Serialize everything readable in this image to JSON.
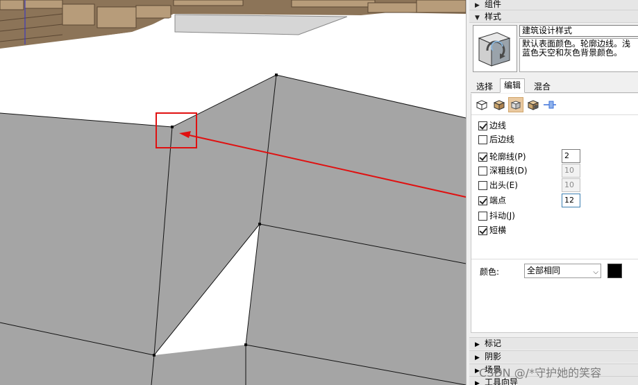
{
  "panel": {
    "top_tray": {
      "arrow": "▶",
      "label": "组件"
    },
    "style_tray": {
      "arrow": "▼",
      "label": "样式"
    },
    "style_name": "建筑设计样式",
    "style_description": "默认表面颜色。轮廓边线。浅蓝色天空和灰色背景颜色。",
    "tabs": [
      {
        "label": "选择"
      },
      {
        "label": "编辑"
      },
      {
        "label": "混合"
      }
    ],
    "edge_settings": {
      "edges": {
        "label": "边线",
        "checked": true
      },
      "back_edges": {
        "label": "后边线",
        "checked": false
      },
      "profiles": {
        "label": "轮廓线(P)",
        "checked": true,
        "value": "2"
      },
      "depth_cue": {
        "label": "深粗线(D)",
        "checked": false,
        "value": "10"
      },
      "extension": {
        "label": "出头(E)",
        "checked": false,
        "value": "10"
      },
      "endpoints": {
        "label": "端点",
        "checked": true,
        "value": "12"
      },
      "jitter": {
        "label": "抖动(J)",
        "checked": false
      },
      "short_dash": {
        "label": "短横",
        "checked": true
      }
    },
    "color": {
      "label": "颜色:",
      "selected": "全部相同",
      "swatch": "#000000"
    },
    "lower_trays": [
      {
        "arrow": "▶",
        "label": "标记"
      },
      {
        "arrow": "▶",
        "label": "阴影"
      },
      {
        "arrow": "▶",
        "label": "场景"
      },
      {
        "arrow": "▶",
        "label": "工具向导"
      }
    ]
  },
  "viewport": {
    "wall_color": "#a5a5a5",
    "highlight_color": "#e01010",
    "roof_color": "#ffffff",
    "ground_color": "#8c7458"
  },
  "watermark": "CSDN @/*守护她的笑容"
}
